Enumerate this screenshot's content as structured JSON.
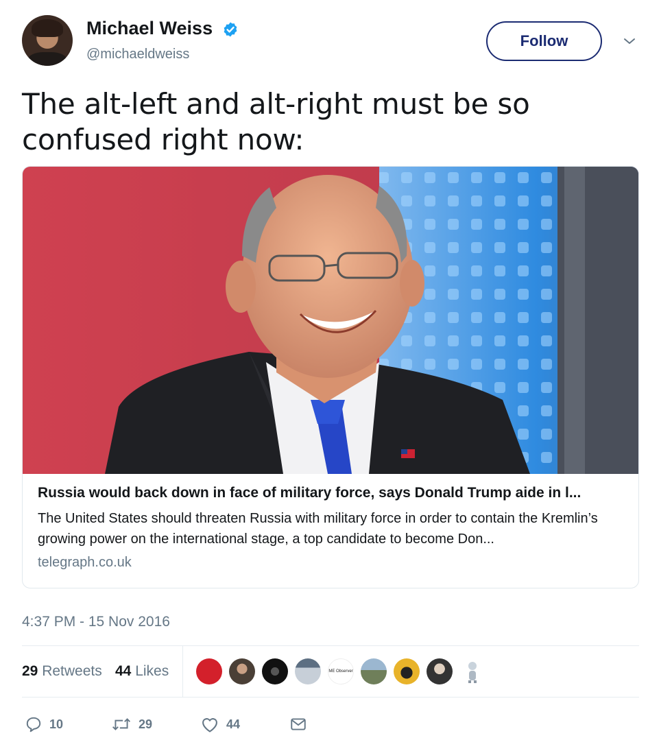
{
  "author": {
    "display_name": "Michael Weiss",
    "handle": "@michaeldweiss",
    "verified": true,
    "avatar_icon": "profile-avatar"
  },
  "follow_button": {
    "label": "Follow"
  },
  "tweet": {
    "text": "The alt-left and alt-right must be so confused right now:"
  },
  "card": {
    "title": "Russia would back down in face of military force, says Donald Trump aide in l...",
    "description": "The United States should threaten Russia with military force in order to contain the Kremlin’s growing power on the international stage, a top candidate to become Don...",
    "domain": "telegraph.co.uk"
  },
  "timestamp": "4:37 PM - 15 Nov 2016",
  "stats": {
    "retweets_count": "29",
    "retweets_label": "Retweets",
    "likes_count": "44",
    "likes_label": "Likes"
  },
  "likers": [
    {
      "icon": "red-circle-avatar",
      "color": "#d3202b"
    },
    {
      "icon": "man-avatar",
      "color": "#4a3f36"
    },
    {
      "icon": "hooded-figure-avatar",
      "color": "#222222"
    },
    {
      "icon": "document-avatar",
      "color": "#5d6f82"
    },
    {
      "icon": "me-observer-logo",
      "label": "ME Observer"
    },
    {
      "icon": "landscape-avatar",
      "color": "#6f7f5a"
    },
    {
      "icon": "cartoon-avatar",
      "color": "#e8b32a"
    },
    {
      "icon": "portrait-avatar",
      "color": "#333333"
    },
    {
      "icon": "robot-avatar",
      "color": "#c9d3dc"
    }
  ],
  "actions": {
    "reply_count": "10",
    "retweet_count": "29",
    "like_count": "44"
  },
  "colors": {
    "link_blue": "#1b2b72",
    "verified_blue": "#1da1f2",
    "muted": "#657786",
    "text": "#14171a",
    "border": "#e1e8ed"
  }
}
